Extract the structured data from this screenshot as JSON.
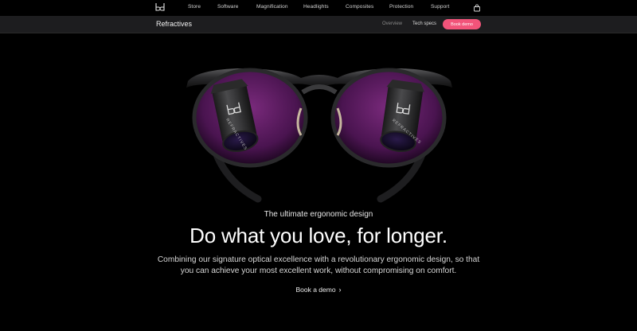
{
  "topnav": {
    "items": [
      {
        "label": "Store"
      },
      {
        "label": "Software"
      },
      {
        "label": "Magnification"
      },
      {
        "label": "Headlights"
      },
      {
        "label": "Composites"
      },
      {
        "label": "Protection"
      },
      {
        "label": "Support"
      }
    ],
    "icons": {
      "logo": "bd-logo",
      "bag": "shopping-bag-icon"
    }
  },
  "subnav": {
    "product": "Refractives",
    "links": [
      {
        "label": "Overview"
      },
      {
        "label": "Tech specs"
      }
    ],
    "cta_label": "Book demo",
    "cta_color": "#f2547a"
  },
  "hero": {
    "eyebrow": "The ultimate ergonomic design",
    "headline": "Do what you love, for longer.",
    "body": "Combining our signature optical excellence with a revolutionary ergonomic design, so that you can achieve your most excellent work, without compromising on comfort.",
    "cta_label": "Book a demo",
    "lens_brand": "REFRACTIVES",
    "lens_tint": "#5a1a5e"
  },
  "colors": {
    "background": "#000000",
    "subnav_bg": "#1d1d1f",
    "accent": "#f2547a"
  }
}
